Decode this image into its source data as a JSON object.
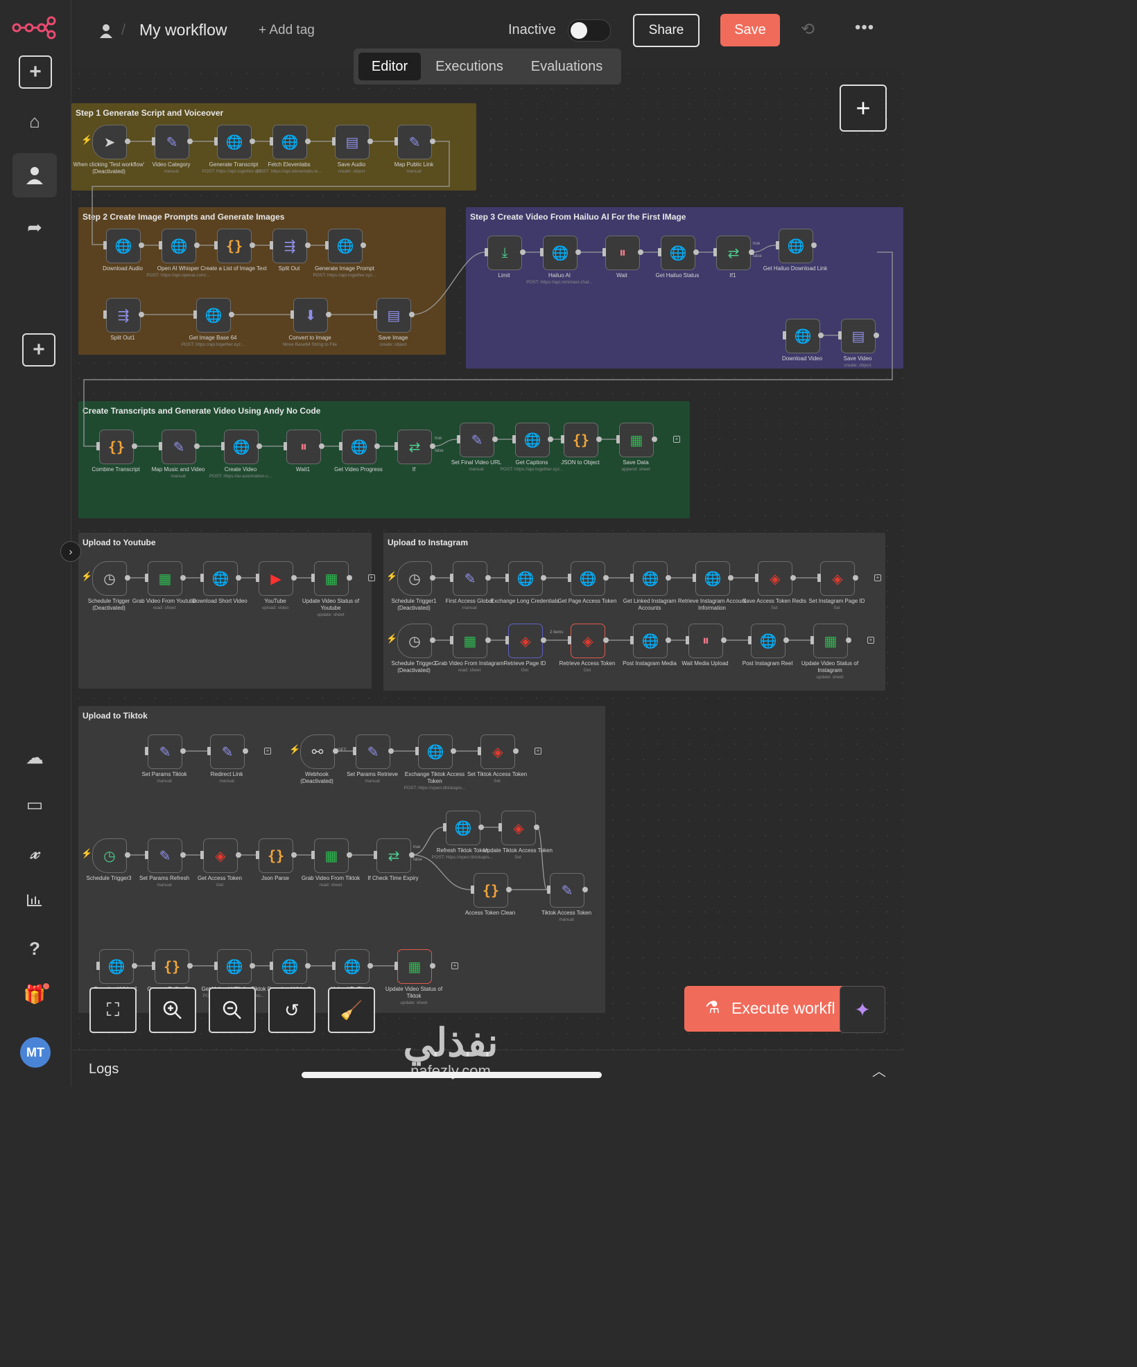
{
  "header": {
    "title": "My workflow",
    "add_tag": "+ Add tag",
    "status": "Inactive",
    "share": "Share",
    "save": "Save"
  },
  "tabs": [
    "Editor",
    "Executions",
    "Evaluations"
  ],
  "user": {
    "initials": "MT"
  },
  "notes": [
    {
      "title": "Step 1 Generate Script and Voiceover",
      "color": "#5a4d1e"
    },
    {
      "title": "Step 2 Create Image Prompts and Generate Images",
      "color": "#5a4220"
    },
    {
      "title": "Step 3 Create Video From Hailuo AI For the First IMage",
      "color": "#3f3a6a"
    },
    {
      "title": "Create Transcripts and Generate Video Using Andy No Code",
      "color": "#1f4a30"
    },
    {
      "title": "Upload to Youtube",
      "color": "#3a3a3a"
    },
    {
      "title": "Upload to Instagram",
      "color": "#3a3a3a"
    },
    {
      "title": "Upload to Tiktok",
      "color": "#3a3a3a"
    }
  ],
  "nodes": [
    {
      "id": "n1",
      "label": "When clicking 'Test workflow'",
      "sub": "(Deactivated)",
      "icon": "pointer-icon",
      "glyph": "➤",
      "color": "#cfcfcf",
      "trigger": true
    },
    {
      "id": "n2",
      "label": "Video Category",
      "sub": "manual",
      "icon": "pencil-icon",
      "glyph": "✎",
      "color": "#8f8fe8"
    },
    {
      "id": "n3",
      "label": "Generate Transcript",
      "sub": "POST: https://api.together.xyz...",
      "icon": "globe-icon",
      "glyph": "🌐",
      "color": "#8f8fe8"
    },
    {
      "id": "n4",
      "label": "Fetch Elevenlabs",
      "sub": "POST: https://api.elevenlabs.io...",
      "icon": "globe-icon",
      "glyph": "🌐",
      "color": "#8f8fe8"
    },
    {
      "id": "n5",
      "label": "Save Audio",
      "sub": "create: object",
      "icon": "storage-icon",
      "glyph": "▤",
      "color": "#8f8fe8"
    },
    {
      "id": "n6",
      "label": "Map Public Link",
      "sub": "manual",
      "icon": "pencil-icon",
      "glyph": "✎",
      "color": "#8f8fe8"
    },
    {
      "id": "n7",
      "label": "Download Audio",
      "sub": "",
      "icon": "globe-icon",
      "glyph": "🌐",
      "color": "#8f8fe8"
    },
    {
      "id": "n8",
      "label": "Open AI Whisper",
      "sub": "POST: https://api.openai.com/...",
      "icon": "globe-icon",
      "glyph": "🌐",
      "color": "#8f8fe8"
    },
    {
      "id": "n9",
      "label": "Create a List of Image Text",
      "sub": "",
      "icon": "code-icon",
      "glyph": "{}",
      "color": "#f2a53a"
    },
    {
      "id": "n10",
      "label": "Split Out",
      "sub": "",
      "icon": "split-icon",
      "glyph": "⇶",
      "color": "#8f8fe8"
    },
    {
      "id": "n11",
      "label": "Generate Image Prompt",
      "sub": "POST: https://api.together.xyz...",
      "icon": "globe-icon",
      "glyph": "🌐",
      "color": "#8f8fe8"
    },
    {
      "id": "n12",
      "label": "Split Out1",
      "sub": "",
      "icon": "split-icon",
      "glyph": "⇶",
      "color": "#8f8fe8"
    },
    {
      "id": "n13",
      "label": "Get Image Base 64",
      "sub": "POST: https://api.together.xyz...",
      "icon": "globe-icon",
      "glyph": "🌐",
      "color": "#8f8fe8"
    },
    {
      "id": "n14",
      "label": "Convert to Image",
      "sub": "Move Base64 String to File",
      "icon": "file-convert-icon",
      "glyph": "⬇",
      "color": "#8f8fe8"
    },
    {
      "id": "n15",
      "label": "Save Image",
      "sub": "create: object",
      "icon": "storage-icon",
      "glyph": "▤",
      "color": "#8f8fe8"
    },
    {
      "id": "n16",
      "label": "Limit",
      "sub": "",
      "icon": "limit-icon",
      "glyph": "⤓",
      "color": "#4fcf8f"
    },
    {
      "id": "n17",
      "label": "Hailuo AI",
      "sub": "POST: https://api.minimaxi.chat...",
      "icon": "globe-icon",
      "glyph": "🌐",
      "color": "#8f8fe8"
    },
    {
      "id": "n18",
      "label": "Wait",
      "sub": "",
      "icon": "pause-icon",
      "glyph": "⏸",
      "color": "#f07a8a"
    },
    {
      "id": "n19",
      "label": "Get Hailuo Status",
      "sub": "",
      "icon": "globe-icon",
      "glyph": "🌐",
      "color": "#8f8fe8"
    },
    {
      "id": "n20",
      "label": "If1",
      "sub": "",
      "icon": "if-icon",
      "glyph": "⇄",
      "color": "#4fcf8f"
    },
    {
      "id": "n21",
      "label": "Get Hailuo Download Link",
      "sub": "",
      "icon": "globe-icon",
      "glyph": "🌐",
      "color": "#8f8fe8"
    },
    {
      "id": "n22",
      "label": "Download Video",
      "sub": "",
      "icon": "globe-icon",
      "glyph": "🌐",
      "color": "#8f8fe8"
    },
    {
      "id": "n23",
      "label": "Save Video",
      "sub": "create: object",
      "icon": "storage-icon",
      "glyph": "▤",
      "color": "#8f8fe8"
    },
    {
      "id": "n24",
      "label": "Combine Transcript",
      "sub": "",
      "icon": "code-icon",
      "glyph": "{}",
      "color": "#f2a53a"
    },
    {
      "id": "n25",
      "label": "Map Music and Video",
      "sub": "manual",
      "icon": "pencil-icon",
      "glyph": "✎",
      "color": "#8f8fe8"
    },
    {
      "id": "n26",
      "label": "Create Video",
      "sub": "POST: https://ai-automation-c...",
      "icon": "globe-icon",
      "glyph": "🌐",
      "color": "#8f8fe8"
    },
    {
      "id": "n27",
      "label": "Wait1",
      "sub": "",
      "icon": "pause-icon",
      "glyph": "⏸",
      "color": "#f07a8a"
    },
    {
      "id": "n28",
      "label": "Get Video Progress",
      "sub": "",
      "icon": "globe-icon",
      "glyph": "🌐",
      "color": "#8f8fe8"
    },
    {
      "id": "n29",
      "label": "If",
      "sub": "",
      "icon": "if-icon",
      "glyph": "⇄",
      "color": "#4fcf8f"
    },
    {
      "id": "n30",
      "label": "Set Final Video URL",
      "sub": "manual",
      "icon": "pencil-icon",
      "glyph": "✎",
      "color": "#8f8fe8"
    },
    {
      "id": "n31",
      "label": "Get Captions",
      "sub": "POST: https://api.together.xyz...",
      "icon": "globe-icon",
      "glyph": "🌐",
      "color": "#8f8fe8"
    },
    {
      "id": "n32",
      "label": "JSON to Object",
      "sub": "",
      "icon": "code-icon",
      "glyph": "{}",
      "color": "#f2a53a"
    },
    {
      "id": "n33",
      "label": "Save Data",
      "sub": "append: sheet",
      "icon": "sheets-icon",
      "glyph": "▦",
      "color": "#2db84f"
    },
    {
      "id": "n34",
      "label": "Schedule Trigger",
      "sub": "(Deactivated)",
      "icon": "clock-icon",
      "glyph": "◷",
      "color": "#cfcfcf",
      "trigger": true
    },
    {
      "id": "n35",
      "label": "Grab Video From Youtube",
      "sub": "read: sheet",
      "icon": "sheets-icon",
      "glyph": "▦",
      "color": "#2db84f"
    },
    {
      "id": "n36",
      "label": "Download Short Video",
      "sub": "",
      "icon": "globe-icon",
      "glyph": "🌐",
      "color": "#8f8fe8"
    },
    {
      "id": "n37",
      "label": "YouTube",
      "sub": "upload: video",
      "icon": "youtube-icon",
      "glyph": "▶",
      "color": "#ff3030"
    },
    {
      "id": "n38",
      "label": "Update Video Status of Youtube",
      "sub": "update: sheet",
      "icon": "sheets-icon",
      "glyph": "▦",
      "color": "#2db84f"
    },
    {
      "id": "n39",
      "label": "Schedule Trigger1",
      "sub": "(Deactivated)",
      "icon": "clock-icon",
      "glyph": "◷",
      "color": "#cfcfcf",
      "trigger": true
    },
    {
      "id": "n40",
      "label": "First Access Global",
      "sub": "manual",
      "icon": "pencil-icon",
      "glyph": "✎",
      "color": "#8f8fe8"
    },
    {
      "id": "n41",
      "label": "Exchange Long Credentials",
      "sub": "",
      "icon": "globe-icon",
      "glyph": "🌐",
      "color": "#8f8fe8"
    },
    {
      "id": "n42",
      "label": "Get Page Access Token",
      "sub": "",
      "icon": "globe-icon",
      "glyph": "🌐",
      "color": "#8f8fe8"
    },
    {
      "id": "n43",
      "label": "Get Linked Instagram Accounts",
      "sub": "",
      "icon": "globe-icon",
      "glyph": "🌐",
      "color": "#8f8fe8"
    },
    {
      "id": "n44",
      "label": "Retrieve Instagram Account Information",
      "sub": "",
      "icon": "globe-icon",
      "glyph": "🌐",
      "color": "#8f8fe8"
    },
    {
      "id": "n45",
      "label": "Save Access Token Redis",
      "sub": "Set",
      "icon": "redis-icon",
      "glyph": "◈",
      "color": "#e03a2f"
    },
    {
      "id": "n46",
      "label": "Set Instagram Page ID",
      "sub": "Set",
      "icon": "redis-icon",
      "glyph": "◈",
      "color": "#e03a2f"
    },
    {
      "id": "n47",
      "label": "Schedule Trigger2",
      "sub": "(Deactivated)",
      "icon": "clock-icon",
      "glyph": "◷",
      "color": "#cfcfcf",
      "trigger": true
    },
    {
      "id": "n48",
      "label": "Grab Video From Instagram",
      "sub": "read: sheet",
      "icon": "sheets-icon",
      "glyph": "▦",
      "color": "#2db84f"
    },
    {
      "id": "n49",
      "label": "Retrieve Page ID",
      "sub": "Get",
      "icon": "redis-icon",
      "glyph": "◈",
      "color": "#e03a2f",
      "border": "blue"
    },
    {
      "id": "n50",
      "label": "Retrieve Access Token",
      "sub": "Get",
      "icon": "redis-icon",
      "glyph": "◈",
      "color": "#e03a2f",
      "border": "red"
    },
    {
      "id": "n51",
      "label": "Post Instagram Media",
      "sub": "",
      "icon": "globe-icon",
      "glyph": "🌐",
      "color": "#8f8fe8"
    },
    {
      "id": "n52",
      "label": "Wait Media Upload",
      "sub": "",
      "icon": "pause-icon",
      "glyph": "⏸",
      "color": "#f07a8a"
    },
    {
      "id": "n53",
      "label": "Post Instagram Reel",
      "sub": "",
      "icon": "globe-icon",
      "glyph": "🌐",
      "color": "#8f8fe8"
    },
    {
      "id": "n54",
      "label": "Update Video Status of Instagram",
      "sub": "update: sheet",
      "icon": "sheets-icon",
      "glyph": "▦",
      "color": "#2db84f"
    },
    {
      "id": "n55",
      "label": "Set Params Tiktok",
      "sub": "manual",
      "icon": "pencil-icon",
      "glyph": "✎",
      "color": "#8f8fe8"
    },
    {
      "id": "n56",
      "label": "Redirect Link",
      "sub": "manual",
      "icon": "pencil-icon",
      "glyph": "✎",
      "color": "#8f8fe8"
    },
    {
      "id": "n57",
      "label": "Webhook",
      "sub": "(Deactivated)",
      "icon": "webhook-icon",
      "glyph": "⚯",
      "color": "#cfcfcf",
      "trigger": true
    },
    {
      "id": "n58",
      "label": "Set Params Retrieve",
      "sub": "manual",
      "icon": "pencil-icon",
      "glyph": "✎",
      "color": "#8f8fe8"
    },
    {
      "id": "n59",
      "label": "Exchange Tiktok Access Token",
      "sub": "POST: https://open.tiktokapis...",
      "icon": "globe-icon",
      "glyph": "🌐",
      "color": "#8f8fe8"
    },
    {
      "id": "n60",
      "label": "Set Tiktok Access Token",
      "sub": "Set",
      "icon": "redis-icon",
      "glyph": "◈",
      "color": "#e03a2f"
    },
    {
      "id": "n61",
      "label": "Schedule Trigger3",
      "sub": "",
      "icon": "clock-icon",
      "glyph": "◷",
      "color": "#4fcf8f",
      "trigger": true
    },
    {
      "id": "n62",
      "label": "Set Params Refresh",
      "sub": "manual",
      "icon": "pencil-icon",
      "glyph": "✎",
      "color": "#8f8fe8"
    },
    {
      "id": "n63",
      "label": "Get Access Token",
      "sub": "Get",
      "icon": "redis-icon",
      "glyph": "◈",
      "color": "#e03a2f"
    },
    {
      "id": "n64",
      "label": "Json Parse",
      "sub": "",
      "icon": "code-icon",
      "glyph": "{}",
      "color": "#f2a53a"
    },
    {
      "id": "n65",
      "label": "Grab Video From Tiktok",
      "sub": "read: sheet",
      "icon": "sheets-icon",
      "glyph": "▦",
      "color": "#2db84f"
    },
    {
      "id": "n66",
      "label": "If Check Time Expiry",
      "sub": "",
      "icon": "if-icon",
      "glyph": "⇄",
      "color": "#4fcf8f"
    },
    {
      "id": "n67",
      "label": "Refresh Tiktok Token",
      "sub": "POST: https://open.tiktokapis...",
      "icon": "globe-icon",
      "glyph": "🌐",
      "color": "#8f8fe8"
    },
    {
      "id": "n68",
      "label": "Update Tiktok Access Token",
      "sub": "Set",
      "icon": "redis-icon",
      "glyph": "◈",
      "color": "#e03a2f"
    },
    {
      "id": "n69",
      "label": "Access Token Clean",
      "sub": "",
      "icon": "code-icon",
      "glyph": "{}",
      "color": "#f2a53a"
    },
    {
      "id": "n70",
      "label": "Tiktok Access Token",
      "sub": "manual",
      "icon": "pencil-icon",
      "glyph": "✎",
      "color": "#8f8fe8"
    },
    {
      "id": "n71",
      "label": "Download Video1",
      "sub": "",
      "icon": "globe-icon",
      "glyph": "🌐",
      "color": "#8f8fe8"
    },
    {
      "id": "n72",
      "label": "Convert Buffer Size",
      "sub": "",
      "icon": "code-icon",
      "glyph": "{}",
      "color": "#f2a53a"
    },
    {
      "id": "n73",
      "label": "Get Upload URL for Tiktok",
      "sub": "POST: https://open.tiktokapis...",
      "icon": "globe-icon",
      "glyph": "🌐",
      "color": "#8f8fe8"
    },
    {
      "id": "n74",
      "label": "Download Video2",
      "sub": "",
      "icon": "globe-icon",
      "glyph": "🌐",
      "color": "#8f8fe8"
    },
    {
      "id": "n75",
      "label": "Upload To Tiktok",
      "sub": "",
      "icon": "globe-icon",
      "glyph": "🌐",
      "color": "#8f8fe8"
    },
    {
      "id": "n76",
      "label": "Update Video Status of Tiktok",
      "sub": "update: sheet",
      "icon": "sheets-icon",
      "glyph": "▦",
      "color": "#2db84f",
      "border": "red"
    }
  ],
  "edge_labels": {
    "true": "true",
    "false": "false",
    "items": "2 items",
    "get": "GET"
  },
  "buttons": {
    "execute": "Execute workfl"
  },
  "logs": {
    "label": "Logs"
  },
  "watermark": {
    "ar": "نفذلي",
    "en": "nafezly.com"
  }
}
